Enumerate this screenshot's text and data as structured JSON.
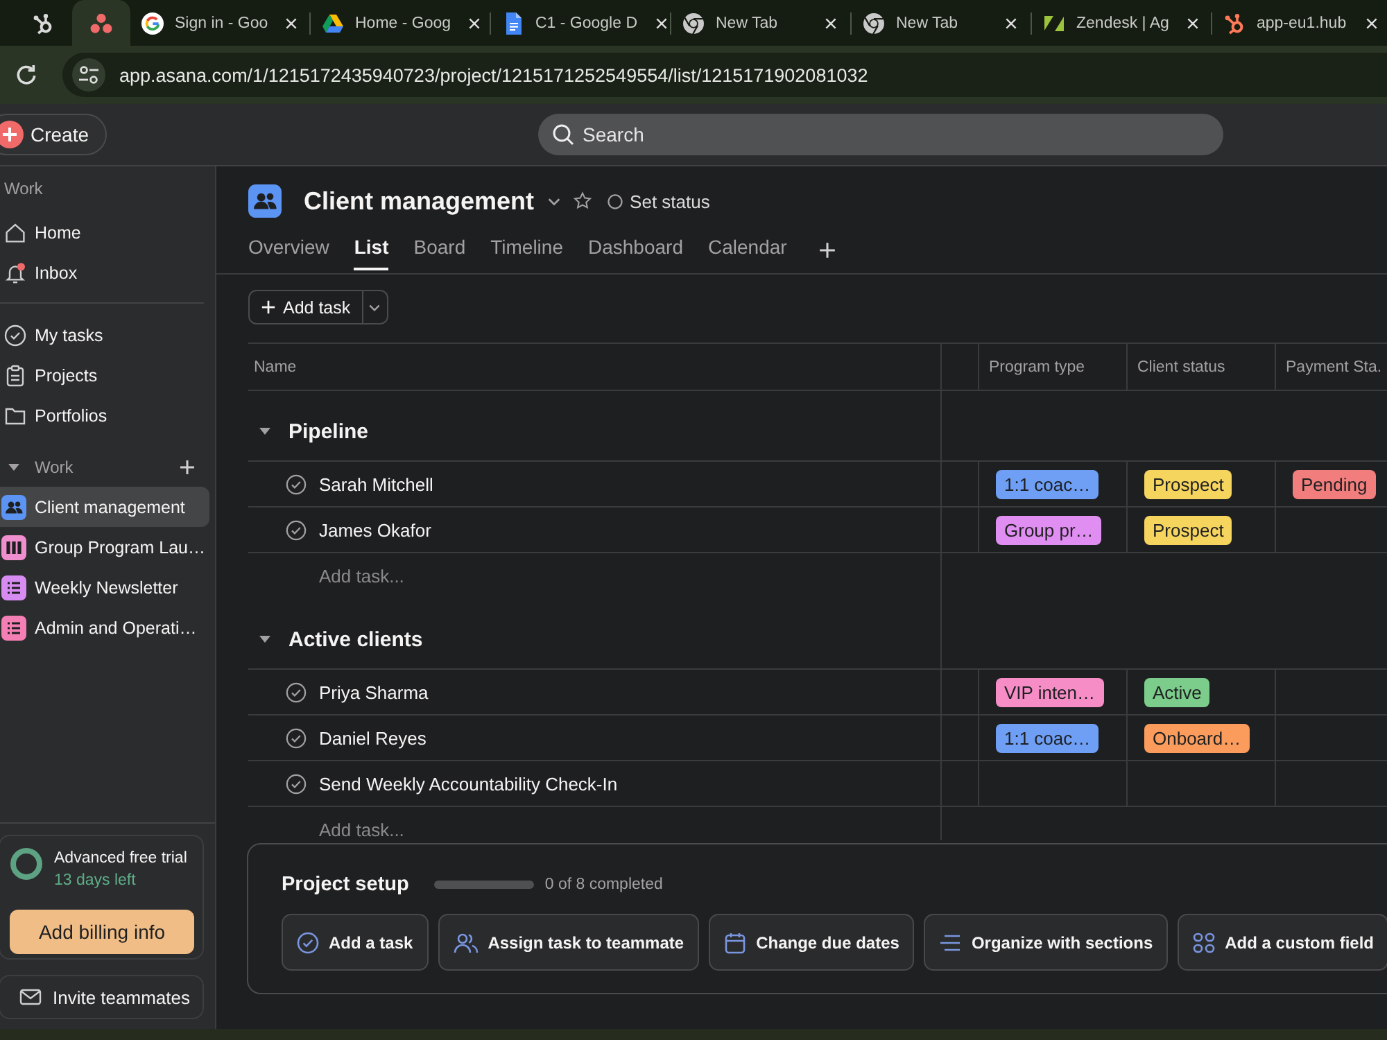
{
  "browser": {
    "tabs": [
      {
        "selected": false
      },
      {
        "selected": true
      },
      {
        "title": "Sign in - Goo",
        "selected": false
      },
      {
        "title": "Home - Goog",
        "selected": false
      },
      {
        "title": "C1 - Google D",
        "selected": false
      },
      {
        "title": "New Tab",
        "selected": false
      },
      {
        "title": "New Tab",
        "selected": false
      },
      {
        "title": "Zendesk | Ag",
        "selected": false
      },
      {
        "title": "app-eu1.hub",
        "selected": false
      }
    ],
    "url": "app.asana.com/1/1215172435940723/project/1215171252549554/list/1215171902081032"
  },
  "topbar": {
    "create": "Create",
    "search": {
      "placeholder": "Search"
    }
  },
  "sidebar": {
    "label": "Work",
    "nav": [
      {
        "label": "Home",
        "selected": false,
        "unread": false
      },
      {
        "label": "Inbox",
        "selected": false,
        "unread": true
      }
    ],
    "nav2": [
      {
        "label": "My tasks",
        "selected": false
      },
      {
        "label": "Projects",
        "selected": false
      },
      {
        "label": "Portfolios",
        "selected": false
      }
    ],
    "section": {
      "title": "Work",
      "expanded": true,
      "projects": [
        {
          "label": "Client management",
          "selected": true,
          "color": "#5b94f2"
        },
        {
          "label": "Group Program Lau…",
          "selected": false,
          "color": "#f08fcd"
        },
        {
          "label": "Weekly Newsletter",
          "selected": false,
          "color": "#d68cf0"
        },
        {
          "label": "Admin and Operati…",
          "selected": false,
          "color": "#f47fb4"
        }
      ]
    },
    "trial": {
      "title": "Advanced free trial",
      "remaining": "13 days left",
      "button": "Add billing info"
    },
    "invite": "Invite teammates"
  },
  "project": {
    "title": "Client management",
    "status": "Set status",
    "tabs": [
      {
        "label": "Overview",
        "selected": false
      },
      {
        "label": "List",
        "selected": true
      },
      {
        "label": "Board",
        "selected": false
      },
      {
        "label": "Timeline",
        "selected": false
      },
      {
        "label": "Dashboard",
        "selected": false
      },
      {
        "label": "Calendar",
        "selected": false
      }
    ],
    "add_task": "Add task"
  },
  "table": {
    "columns": [
      "Name",
      "Program type",
      "Client status",
      "Payment Sta."
    ],
    "sections": [
      {
        "title": "Pipeline",
        "expanded": true,
        "rows": [
          {
            "name": "Sarah Mitchell",
            "completed": false,
            "cells": [
              {
                "text": "1:1 coac…",
                "color": "#6e9ff5"
              },
              {
                "text": "Prospect",
                "color": "#f6d55f"
              },
              {
                "text": "Pending",
                "color": "#f27d7d"
              }
            ]
          },
          {
            "name": "James Okafor",
            "completed": false,
            "cells": [
              {
                "text": "Group pr…",
                "color": "#e18ef2"
              },
              {
                "text": "Prospect",
                "color": "#f6d55f"
              },
              null
            ]
          }
        ],
        "add_task": "Add task..."
      },
      {
        "title": "Active clients",
        "expanded": true,
        "rows": [
          {
            "name": "Priya Sharma",
            "completed": false,
            "cells": [
              {
                "text": "VIP inten…",
                "color": "#f78dc6"
              },
              {
                "text": "Active",
                "color": "#7ccc8b"
              },
              null
            ]
          },
          {
            "name": "Daniel Reyes",
            "completed": false,
            "cells": [
              {
                "text": "1:1 coac…",
                "color": "#6e9ff5"
              },
              {
                "text": "Onboard…",
                "color": "#fb9c5c"
              },
              null
            ]
          },
          {
            "name": "Send Weekly Accountability Check-In",
            "completed": false,
            "cells": [
              null,
              null,
              null
            ]
          }
        ],
        "add_task": "Add task..."
      }
    ]
  },
  "setup": {
    "title": "Project setup",
    "level": 0,
    "progress": "0 of 8 completed",
    "actions": [
      "Add a task",
      "Assign task to teammate",
      "Change due dates",
      "Organize with sections",
      "Add a custom field"
    ]
  }
}
